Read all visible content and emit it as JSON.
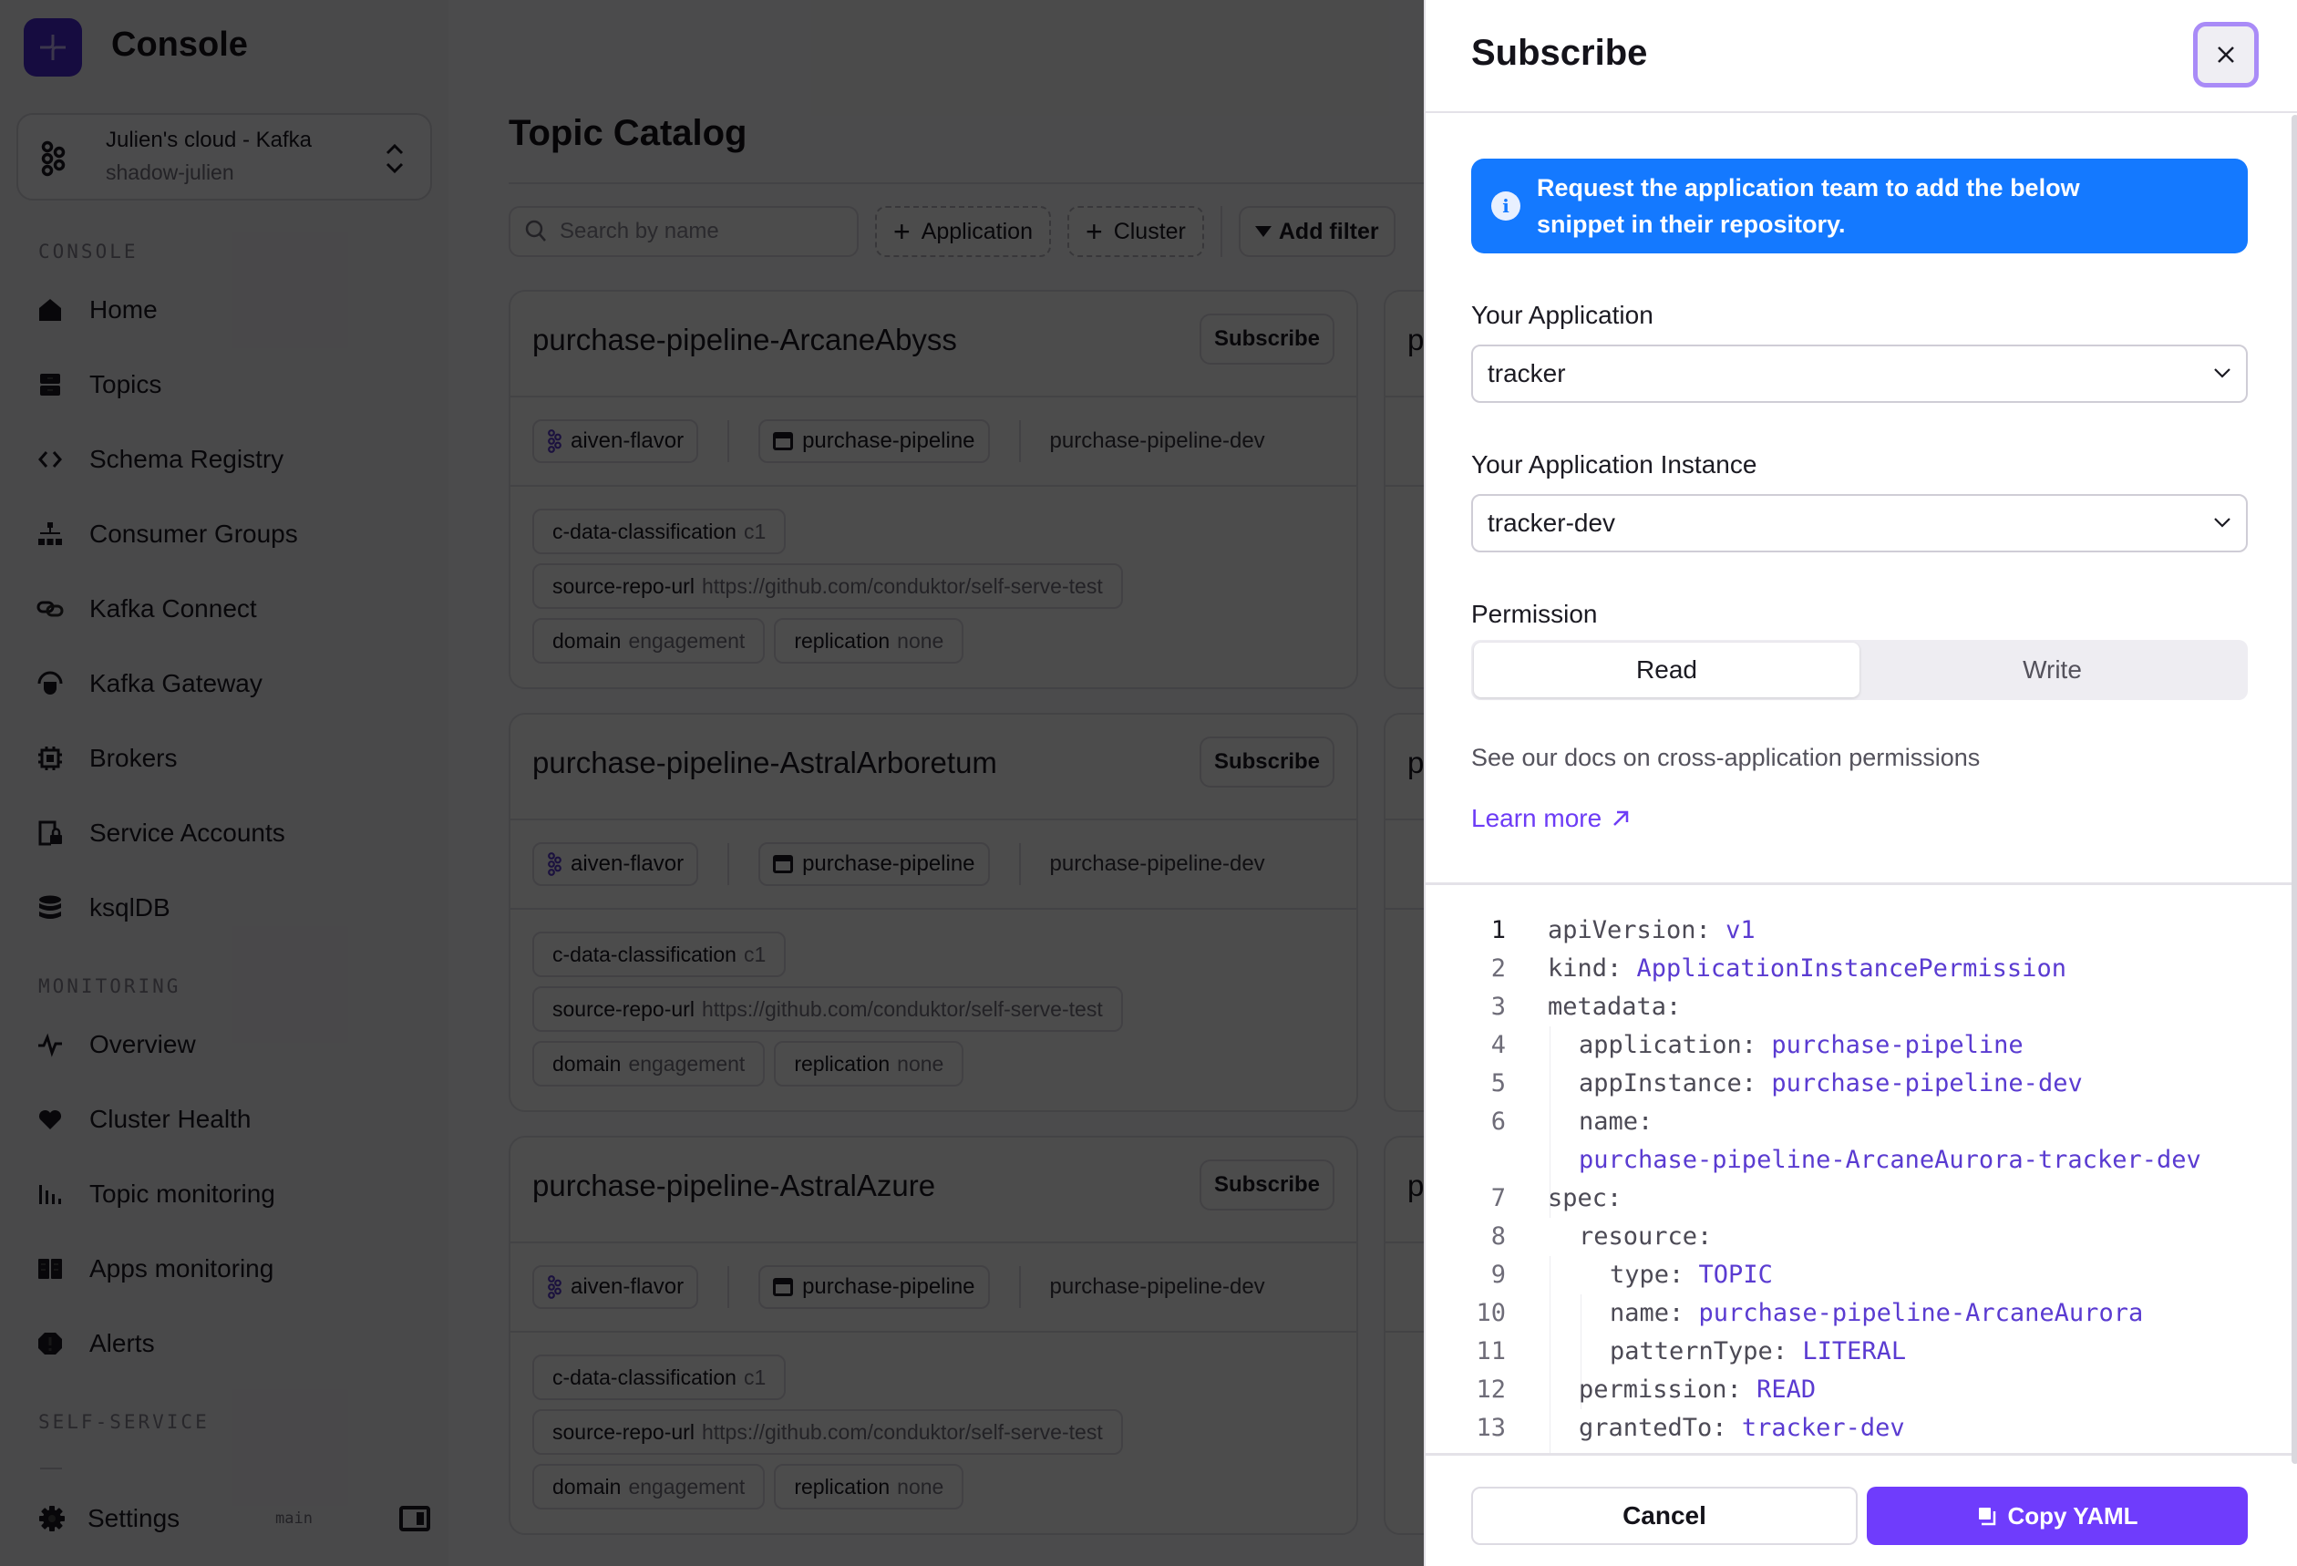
{
  "app": {
    "title": "Console",
    "cluster": {
      "name": "Julien's cloud - Kafka",
      "subtitle": "shadow-julien"
    }
  },
  "sidebar": {
    "sections": [
      {
        "label": "CONSOLE",
        "items": [
          {
            "label": "Home",
            "icon": "home-icon"
          },
          {
            "label": "Topics",
            "icon": "topics-icon"
          },
          {
            "label": "Schema Registry",
            "icon": "code-brackets-icon"
          },
          {
            "label": "Consumer Groups",
            "icon": "hierarchy-icon"
          },
          {
            "label": "Kafka Connect",
            "icon": "link-icon"
          },
          {
            "label": "Kafka Gateway",
            "icon": "gateway-icon"
          },
          {
            "label": "Brokers",
            "icon": "chip-icon"
          },
          {
            "label": "Service Accounts",
            "icon": "lock-device-icon"
          },
          {
            "label": "ksqlDB",
            "icon": "database-icon"
          }
        ]
      },
      {
        "label": "MONITORING",
        "items": [
          {
            "label": "Overview",
            "icon": "pulse-icon"
          },
          {
            "label": "Cluster Health",
            "icon": "heart-icon"
          },
          {
            "label": "Topic monitoring",
            "icon": "bar-chart-icon"
          },
          {
            "label": "Apps monitoring",
            "icon": "apps-icon"
          },
          {
            "label": "Alerts",
            "icon": "alert-icon"
          }
        ]
      },
      {
        "label": "SELF-SERVICE",
        "items": []
      }
    ],
    "settings_label": "Settings",
    "branch": "main"
  },
  "main": {
    "title": "Topic Catalog",
    "search_placeholder": "Search by name",
    "filters": {
      "application": "Application",
      "cluster": "Cluster",
      "add_filter": "Add filter"
    },
    "cards": [
      {
        "title": "purchase-pipeline-ArcaneAbyss",
        "subscribe": "Subscribe",
        "cluster": "aiven-flavor",
        "application": "purchase-pipeline",
        "instance": "purchase-pipeline-dev",
        "labels": [
          {
            "key": "c-data-classification",
            "value": "c1"
          },
          {
            "key": "source-repo-url",
            "value": "https://github.com/conduktor/self-serve-test"
          },
          {
            "key": "domain",
            "value": "engagement"
          },
          {
            "key": "replication",
            "value": "none"
          }
        ]
      },
      {
        "title": "purchase-pipeline-AstralArboretum",
        "subscribe": "Subscribe",
        "cluster": "aiven-flavor",
        "application": "purchase-pipeline",
        "instance": "purchase-pipeline-dev",
        "labels": [
          {
            "key": "c-data-classification",
            "value": "c1"
          },
          {
            "key": "source-repo-url",
            "value": "https://github.com/conduktor/self-serve-test"
          },
          {
            "key": "domain",
            "value": "engagement"
          },
          {
            "key": "replication",
            "value": "none"
          }
        ]
      },
      {
        "title": "purchase-pipeline-AstralAzure",
        "subscribe": "Subscribe",
        "cluster": "aiven-flavor",
        "application": "purchase-pipeline",
        "instance": "purchase-pipeline-dev",
        "labels": [
          {
            "key": "c-data-classification",
            "value": "c1"
          },
          {
            "key": "source-repo-url",
            "value": "https://github.com/conduktor/self-serve-test"
          },
          {
            "key": "domain",
            "value": "engagement"
          },
          {
            "key": "replication",
            "value": "none"
          }
        ]
      }
    ],
    "right_column_title_fragment": "p"
  },
  "drawer": {
    "title": "Subscribe",
    "close_icon": "close-icon",
    "info": "Request the application team to add the below snippet in their repository.",
    "application_label": "Your Application",
    "application_value": "tracker",
    "instance_label": "Your Application Instance",
    "instance_value": "tracker-dev",
    "permission_label": "Permission",
    "permission_options": [
      "Read",
      "Write"
    ],
    "permission_selected": "Read",
    "docs_text": "See our docs on cross-application permissions",
    "learn_more": "Learn more",
    "yaml": [
      {
        "n": "1",
        "indent": 0,
        "key": "apiVersion:",
        "value": "v1"
      },
      {
        "n": "2",
        "indent": 0,
        "key": "kind:",
        "value": "ApplicationInstancePermission"
      },
      {
        "n": "3",
        "indent": 0,
        "key": "metadata:",
        "value": ""
      },
      {
        "n": "4",
        "indent": 1,
        "key": "application:",
        "value": "purchase-pipeline"
      },
      {
        "n": "5",
        "indent": 1,
        "key": "appInstance:",
        "value": "purchase-pipeline-dev"
      },
      {
        "n": "6",
        "indent": 1,
        "key": "name:",
        "value": ""
      },
      {
        "n": "",
        "indent": 1,
        "key": "",
        "value": "purchase-pipeline-ArcaneAurora-tracker-dev"
      },
      {
        "n": "7",
        "indent": 0,
        "key": "spec:",
        "value": ""
      },
      {
        "n": "8",
        "indent": 1,
        "key": "resource:",
        "value": ""
      },
      {
        "n": "9",
        "indent": 2,
        "key": "type:",
        "value": "TOPIC"
      },
      {
        "n": "10",
        "indent": 2,
        "key": "name:",
        "value": "purchase-pipeline-ArcaneAurora"
      },
      {
        "n": "11",
        "indent": 2,
        "key": "patternType:",
        "value": "LITERAL"
      },
      {
        "n": "12",
        "indent": 1,
        "key": "permission:",
        "value": "READ"
      },
      {
        "n": "13",
        "indent": 1,
        "key": "grantedTo:",
        "value": "tracker-dev"
      }
    ],
    "cancel": "Cancel",
    "copy": "Copy YAML"
  },
  "colors": {
    "accent": "#6f3cfc",
    "info": "#1479ff",
    "code_value": "#5a3bd1"
  }
}
